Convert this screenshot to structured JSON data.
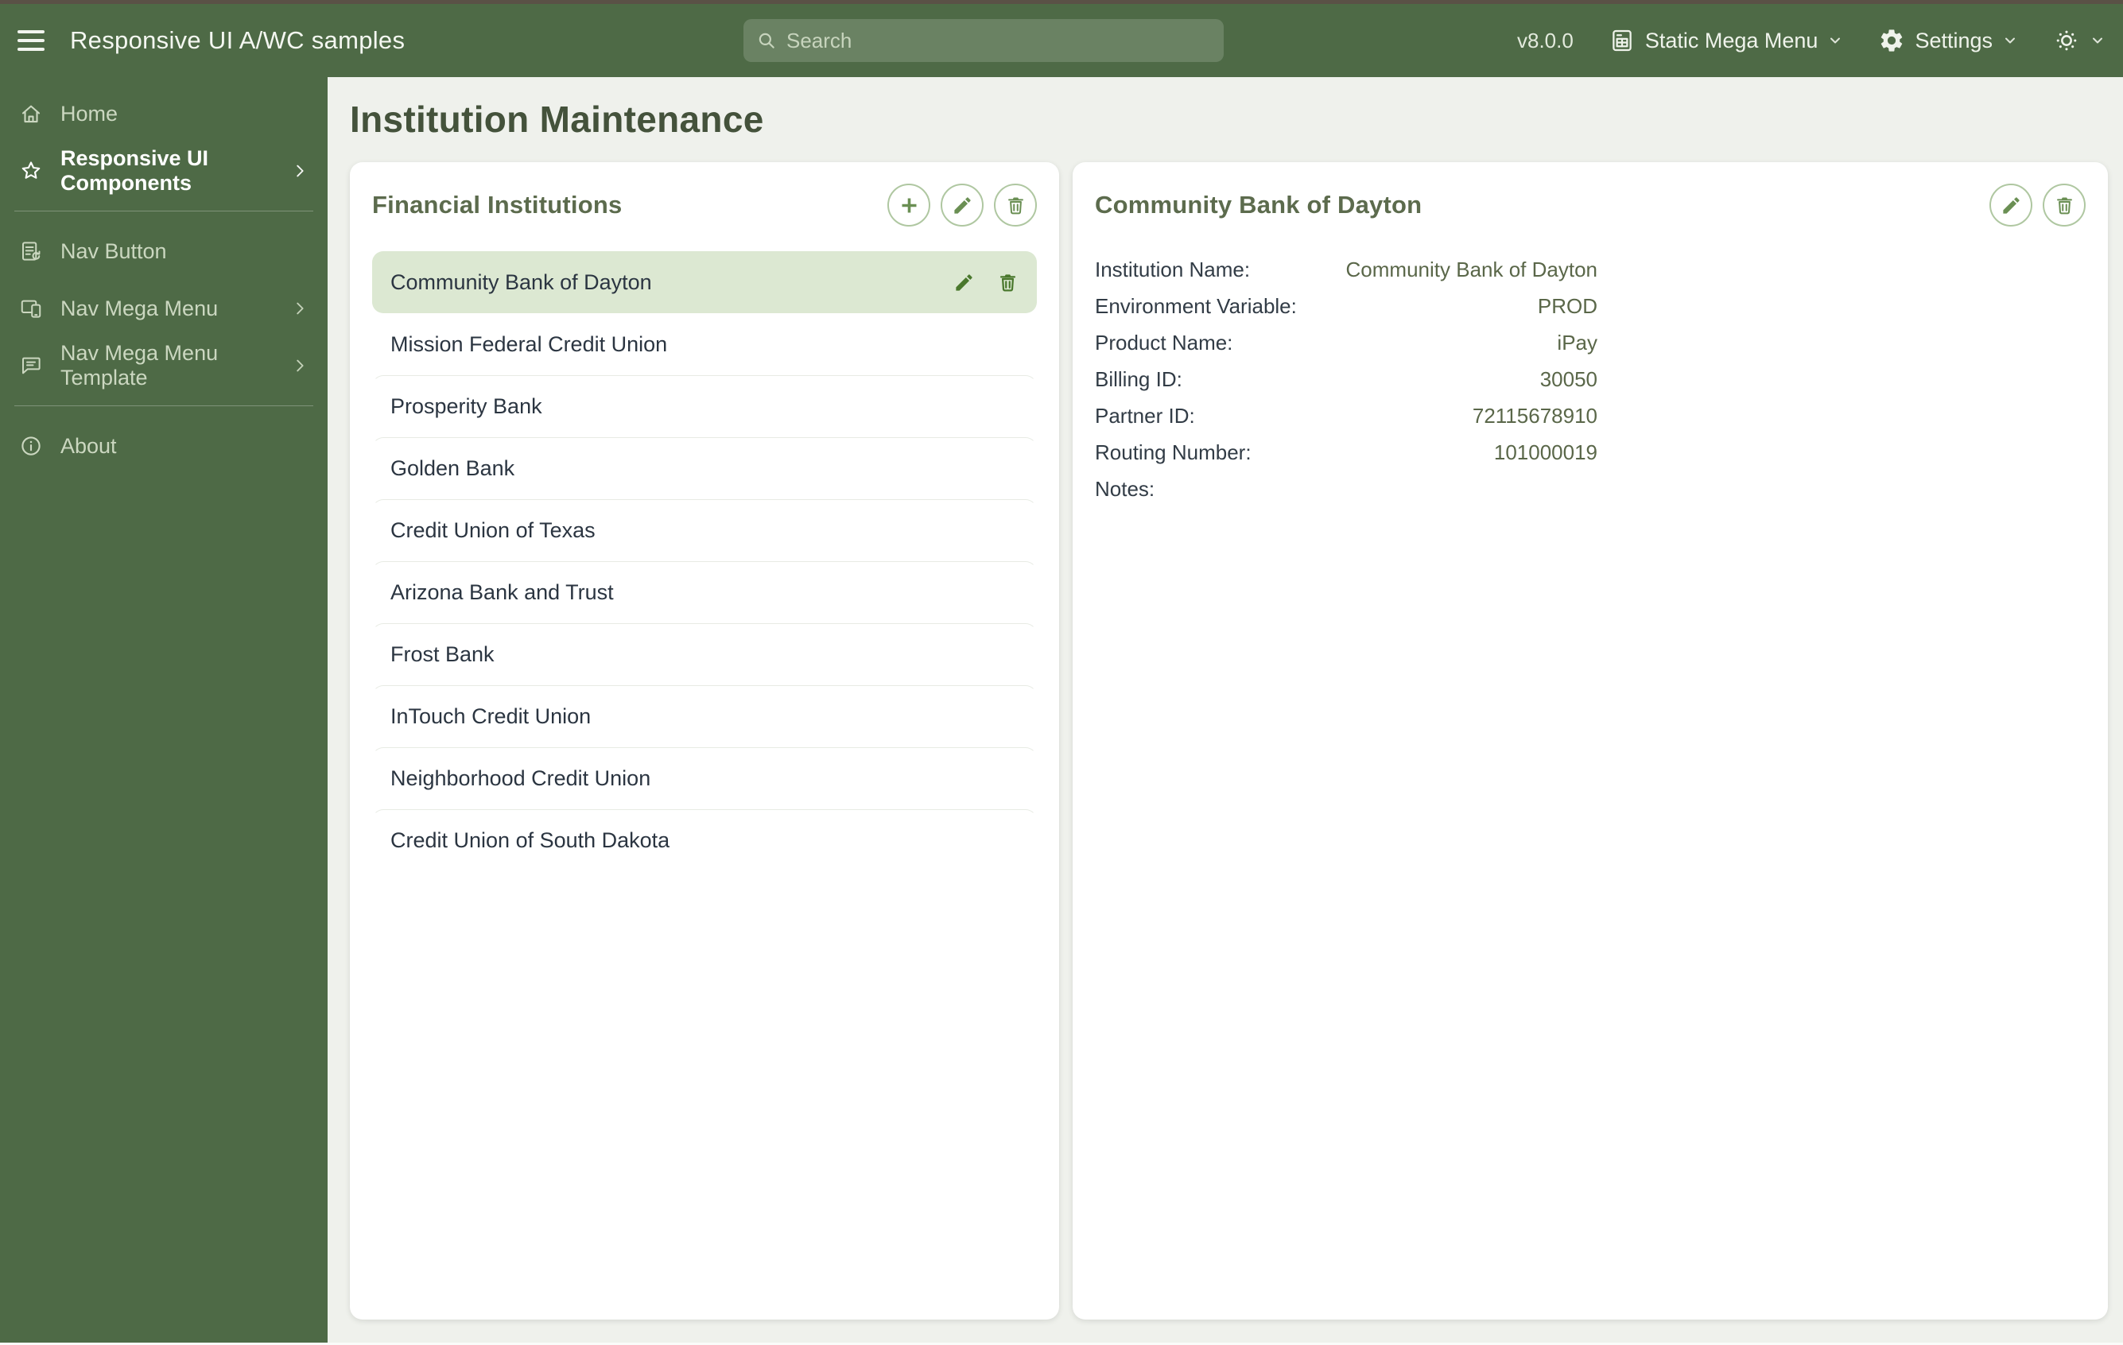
{
  "header": {
    "title": "Responsive UI A/WC samples",
    "search_placeholder": "Search",
    "version": "v8.0.0",
    "mega_menu_label": "Static Mega Menu",
    "settings_label": "Settings"
  },
  "sidebar": {
    "items": [
      {
        "type": "item",
        "label": "Home",
        "icon": "home",
        "interactable": "true"
      },
      {
        "type": "item",
        "label": "Responsive UI Components",
        "icon": "star",
        "active": true,
        "expandable": true,
        "interactable": "true"
      },
      {
        "type": "divider",
        "interactable": "false"
      },
      {
        "type": "item",
        "label": "Nav Button",
        "icon": "nav-button",
        "interactable": "true"
      },
      {
        "type": "item",
        "label": "Nav Mega Menu",
        "icon": "nav-mega-menu",
        "expandable": true,
        "interactable": "true"
      },
      {
        "type": "item",
        "label": "Nav Mega Menu Template",
        "icon": "nav-mega-menu-template",
        "expandable": true,
        "interactable": "true"
      },
      {
        "type": "divider",
        "interactable": "false"
      },
      {
        "type": "item",
        "label": "About",
        "icon": "info",
        "interactable": "true"
      }
    ]
  },
  "page": {
    "title": "Institution Maintenance"
  },
  "list_panel": {
    "title": "Financial Institutions",
    "items": [
      {
        "name": "Community Bank of Dayton",
        "selected": true
      },
      {
        "name": "Mission Federal Credit Union"
      },
      {
        "name": "Prosperity Bank"
      },
      {
        "name": "Golden Bank"
      },
      {
        "name": "Credit Union of Texas"
      },
      {
        "name": "Arizona Bank and Trust"
      },
      {
        "name": "Frost Bank"
      },
      {
        "name": "InTouch Credit Union"
      },
      {
        "name": "Neighborhood Credit Union"
      },
      {
        "name": "Credit Union of South Dakota"
      }
    ]
  },
  "detail_panel": {
    "title": "Community Bank of Dayton",
    "fields": [
      {
        "label": "Institution Name:",
        "value": "Community Bank of Dayton"
      },
      {
        "label": "Environment Variable:",
        "value": "PROD"
      },
      {
        "label": "Product Name:",
        "value": "iPay"
      },
      {
        "label": "Billing ID:",
        "value": "30050"
      },
      {
        "label": "Partner ID:",
        "value": "72115678910"
      },
      {
        "label": "Routing Number:",
        "value": "101000019"
      },
      {
        "label": "Notes:",
        "value": ""
      }
    ]
  },
  "colors": {
    "brand_green": "#4E6A46",
    "selected_row_green": "#DCE8D2",
    "accent_icon_green": "#6A8F53",
    "page_background": "#EFF1EC"
  }
}
